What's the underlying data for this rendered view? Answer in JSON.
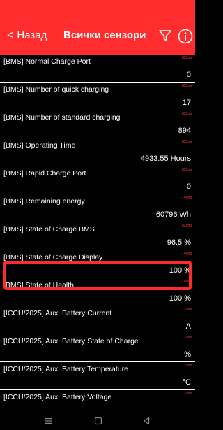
{
  "header": {
    "back_label": "Назад",
    "title": "Всички сензори",
    "icons": [
      "filter-icon",
      "info-icon"
    ]
  },
  "rows": [
    {
      "name": "[BMS] Normal Charge Port",
      "value": "0",
      "ms": "835ms"
    },
    {
      "name": "[BMS] Number of quick charging",
      "value": "17",
      "ms": "835ms"
    },
    {
      "name": "[BMS] Number of standard charging",
      "value": "894",
      "ms": "835ms"
    },
    {
      "name": "[BMS] Operating Time",
      "value": "4933.55 Hours",
      "ms": "835ms"
    },
    {
      "name": "[BMS] Rapid Charge Port",
      "value": "0",
      "ms": "835ms"
    },
    {
      "name": "[BMS] Remaining energy",
      "value": "60796 Wh",
      "ms": "-748ms"
    },
    {
      "name": "[BMS] State of Charge BMS",
      "value": "96.5 %",
      "ms": "835ms"
    },
    {
      "name": "[BMS] State of Charge Display",
      "value": "100 %",
      "ms": "-748ms"
    },
    {
      "name": "[BMS] State of Health",
      "value": "100 %",
      "ms": "-748ms"
    },
    {
      "name": "[ICCU/2025] Aux. Battery Current",
      "value": "A",
      "ms": "0ms"
    },
    {
      "name": "[ICCU/2025] Aux. Battery State of Charge",
      "value": "%",
      "ms": "0ms"
    },
    {
      "name": "[ICCU/2025] Aux. Battery Temperature",
      "value": "°C",
      "ms": "0ms"
    },
    {
      "name": "[ICCU/2025] Aux. Battery Voltage",
      "value": "",
      "ms": "0ms"
    }
  ],
  "navbar": {
    "icons": [
      "menu-icon",
      "home-icon",
      "back-triangle-icon"
    ]
  },
  "colors": {
    "header": "#ff2d2d",
    "background": "#000000",
    "highlight": "#ff2a2a",
    "ms_text": "#ff3b3b"
  }
}
